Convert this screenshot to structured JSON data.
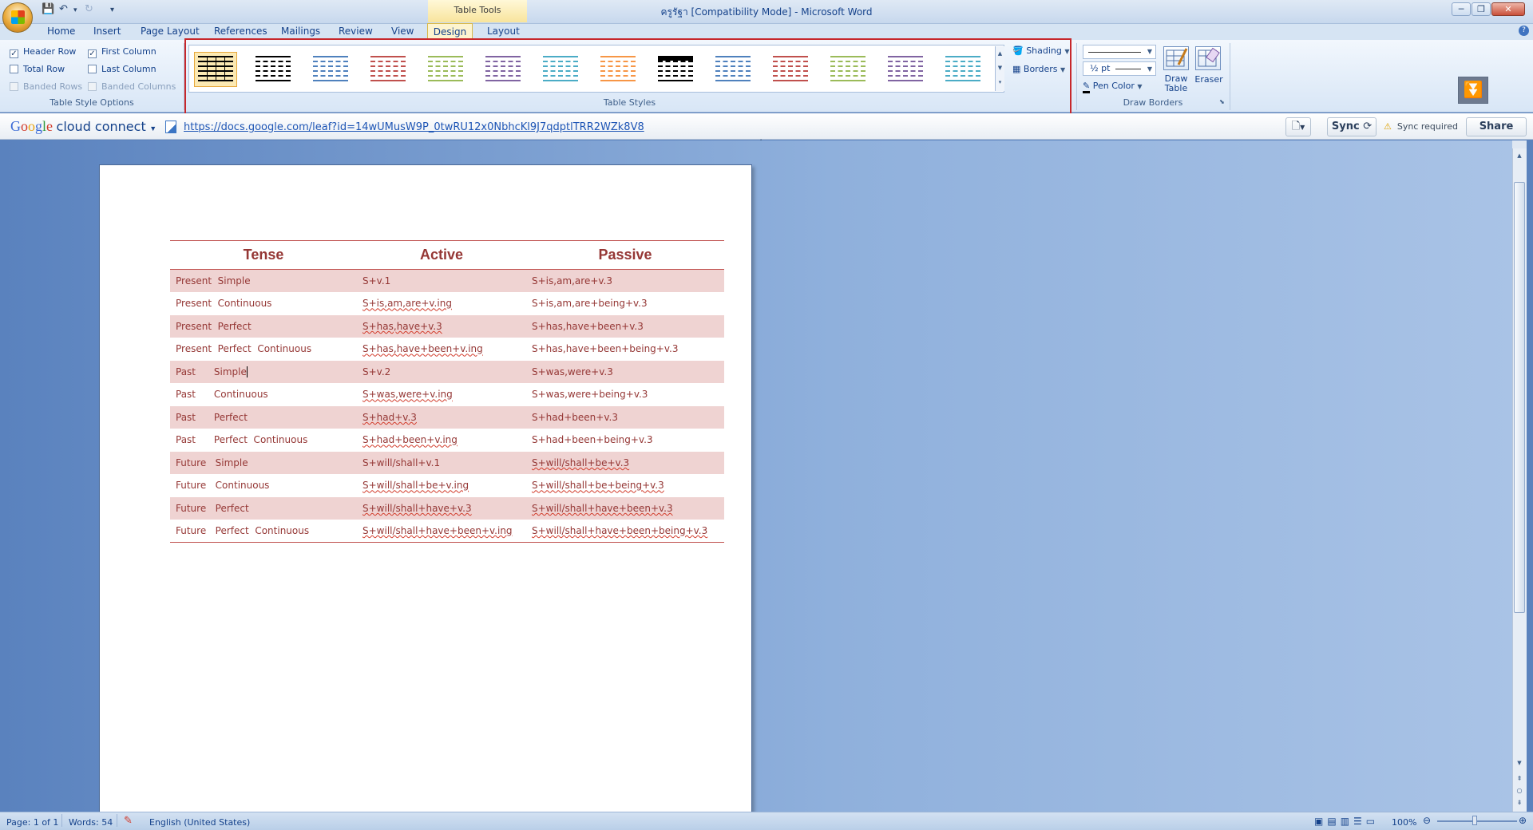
{
  "window": {
    "title": "ครูรัฐา [Compatibility Mode] - Microsoft Word",
    "contextual_group": "Table Tools",
    "controls": [
      "─",
      "❐",
      "✕"
    ]
  },
  "quick_access": {
    "save_icon": "save-icon",
    "undo_icon": "undo-icon",
    "redo_icon": "redo-icon",
    "customize": "▾"
  },
  "tabs": [
    "Home",
    "Insert",
    "Page Layout",
    "References",
    "Mailings",
    "Review",
    "View",
    "Design",
    "Layout"
  ],
  "active_tab": "Design",
  "ribbon": {
    "style_options": {
      "label": "Table Style Options",
      "items": [
        {
          "label": "Header Row",
          "checked": true,
          "enabled": true
        },
        {
          "label": "First Column",
          "checked": true,
          "enabled": true
        },
        {
          "label": "Total Row",
          "checked": false,
          "enabled": true
        },
        {
          "label": "Last Column",
          "checked": false,
          "enabled": true
        },
        {
          "label": "Banded Rows",
          "checked": false,
          "enabled": false
        },
        {
          "label": "Banded Columns",
          "checked": false,
          "enabled": false
        }
      ]
    },
    "table_styles": {
      "label": "Table Styles",
      "colors": [
        "#000000",
        "#000000",
        "#4f81bd",
        "#c0504d",
        "#9bbb59",
        "#8064a2",
        "#4bacc6",
        "#f79646",
        "#000000",
        "#4f81bd",
        "#c0504d",
        "#9bbb59",
        "#8064a2",
        "#4bacc6"
      ],
      "shading": "Shading",
      "borders": "Borders"
    },
    "draw_borders": {
      "label": "Draw Borders",
      "weight": "½ pt",
      "pen_color": "Pen Color",
      "draw_table": "Draw Table",
      "eraser": "Eraser"
    }
  },
  "cloud_bar": {
    "logo_google": "Google",
    "logo_suffix": "cloud connect",
    "url": "https://docs.google.com/leaf?id=14wUMusW9P_0twRU12x0NbhcKl9J7qdptlTRR2WZk8V8",
    "sync": "Sync",
    "sync_status": "Sync required",
    "share": "Share"
  },
  "document": {
    "headers": [
      "Tense",
      "Active",
      "Passive"
    ],
    "rows": [
      {
        "tense": "Present  Simple",
        "active": "S+v.1",
        "passive": "S+is,am,are+v.3"
      },
      {
        "tense": "Present  Continuous",
        "active": "S+is,am,are+v.ing",
        "passive": "S+is,am,are+being+v.3"
      },
      {
        "tense": "Present  Perfect",
        "active": "S+has,have+v.3",
        "passive": "S+has,have+been+v.3"
      },
      {
        "tense": "Present  Perfect  Continuous",
        "active": "S+has,have+been+v.ing",
        "passive": "S+has,have+been+being+v.3"
      },
      {
        "tense": "Past      Simple",
        "active": "S+v.2",
        "passive": "S+was,were+v.3"
      },
      {
        "tense": "Past      Continuous",
        "active": "S+was,were+v.ing",
        "passive": "S+was,were+being+v.3"
      },
      {
        "tense": "Past      Perfect",
        "active": "S+had+v.3",
        "passive": "S+had+been+v.3"
      },
      {
        "tense": "Past      Perfect  Continuous",
        "active": "S+had+been+v.ing",
        "passive": "S+had+been+being+v.3"
      },
      {
        "tense": "Future   Simple",
        "active": "S+will/shall+v.1",
        "passive": "S+will/shall+be+v.3"
      },
      {
        "tense": "Future   Continuous",
        "active": "S+will/shall+be+v.ing",
        "passive": "S+will/shall+be+being+v.3"
      },
      {
        "tense": "Future   Perfect",
        "active": "S+will/shall+have+v.3",
        "passive": "S+will/shall+have+been+v.3"
      },
      {
        "tense": "Future   Perfect  Continuous",
        "active": "S+will/shall+have+been+v.ing",
        "passive": "S+will/shall+have+been+being+v.3"
      }
    ]
  },
  "status": {
    "page": "Page: 1 of 1",
    "words": "Words: 54",
    "language": "English (United States)",
    "zoom": "100%"
  }
}
